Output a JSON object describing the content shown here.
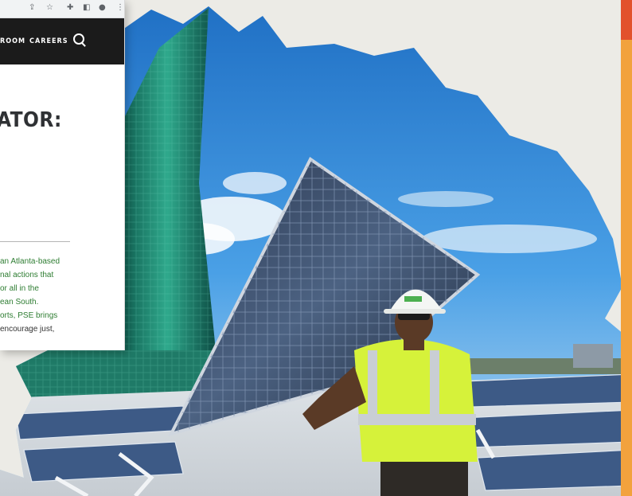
{
  "browser": {
    "toolbar_icons": [
      "share-icon",
      "star-icon",
      "puzzle-icon",
      "sidebar-icon",
      "profile-icon",
      "more-icon"
    ],
    "nav": {
      "items": [
        "ROOM",
        "CAREERS"
      ],
      "search_icon": "search-icon"
    },
    "headline": "ATOR:",
    "body_lines": [
      "an Atlanta-based",
      "nal actions that",
      "or all in the",
      "ean South.",
      "orts, PSE brings",
      "encourage just,"
    ]
  },
  "colors": {
    "nav_bg": "#1b1b1b",
    "link_green": "#2e7d32",
    "vest_yellow": "#d6f23a",
    "sky_blue": "#2f86d6",
    "accent_orange": "#f2a23d",
    "accent_red": "#e2522c"
  }
}
